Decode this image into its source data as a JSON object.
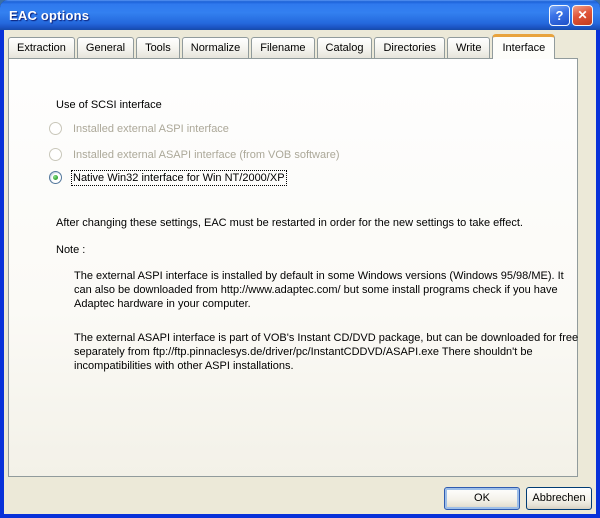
{
  "window": {
    "title": "EAC options",
    "help_icon": "?",
    "close_icon": "✕"
  },
  "tabs": {
    "active": "Interface",
    "items": [
      {
        "label": "Extraction"
      },
      {
        "label": "General"
      },
      {
        "label": "Tools"
      },
      {
        "label": "Normalize"
      },
      {
        "label": "Filename"
      },
      {
        "label": "Catalog"
      },
      {
        "label": "Directories"
      },
      {
        "label": "Write"
      },
      {
        "label": "Interface"
      }
    ]
  },
  "panel": {
    "group_label": "Use of SCSI interface",
    "radios": [
      {
        "label": "Installed external ASPI interface",
        "state": "disabled",
        "selected": false
      },
      {
        "label": "Installed external ASAPI interface (from VOB software)",
        "state": "disabled",
        "selected": false
      },
      {
        "label": "Native Win32 interface for Win NT/2000/XP",
        "state": "enabled",
        "selected": true
      }
    ],
    "restart_note": "After changing these settings, EAC must be restarted in order for the new settings to take effect.",
    "note_label": "Note :",
    "note_paragraphs": [
      "The external ASPI interface is installed by default in some Windows versions (Windows 95/98/ME). It can also be downloaded from http://www.adaptec.com/ but some install programs check if you have Adaptec hardware in your computer.",
      "The external ASAPI interface is part of VOB's Instant CD/DVD package, but can be downloaded for free separately from ftp://ftp.pinnaclesys.de/driver/pc/InstantCDDVD/ASAPI.exe   There shouldn't be incompatibilities with other ASPI installations."
    ]
  },
  "footer": {
    "ok_label": "OK",
    "cancel_label": "Abbrechen"
  },
  "colors": {
    "dialog_bg": "#ECE9D8",
    "window_border_blue": "#0831D9",
    "titlebar_blue": "#2F79EE",
    "tab_active_accent": "#E8A33D",
    "radio_selected_dot": "#2DA12B",
    "default_button_ring": "#9DBEE8",
    "disabled_text": "#ACA899",
    "panel_border": "#919B9C"
  }
}
